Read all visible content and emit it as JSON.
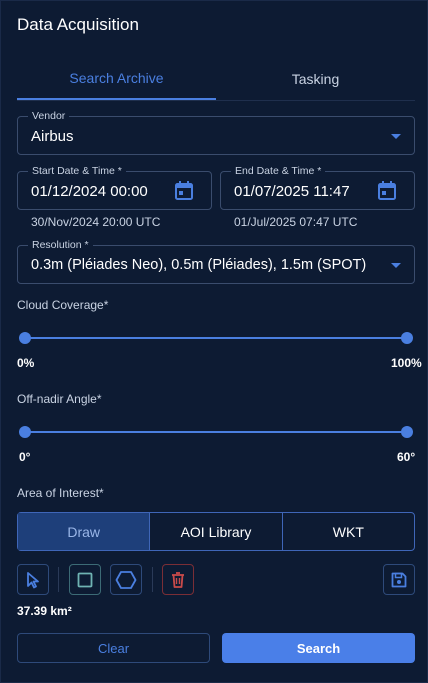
{
  "panel": {
    "title": "Data Acquisition"
  },
  "tabs": [
    {
      "label": "Search Archive",
      "active": true
    },
    {
      "label": "Tasking",
      "active": false
    }
  ],
  "vendor": {
    "label": "Vendor",
    "value": "Airbus"
  },
  "start_date": {
    "label": "Start Date & Time *",
    "value": "01/12/2024 00:00",
    "helper": "30/Nov/2024 20:00 UTC"
  },
  "end_date": {
    "label": "End Date & Time *",
    "value": "01/07/2025 11:47",
    "helper": "01/Jul/2025 07:47 UTC"
  },
  "resolution": {
    "label": "Resolution *",
    "value": "0.3m (Pléiades Neo), 0.5m (Pléiades), 1.5m (SPOT)"
  },
  "cloud_coverage": {
    "label": "Cloud Coverage*",
    "min_label": "0%",
    "max_label": "100%",
    "low": 0,
    "high": 100
  },
  "off_nadir": {
    "label": "Off-nadir Angle*",
    "min_label": "0°",
    "max_label": "60°",
    "low": 0,
    "high": 60
  },
  "aoi": {
    "label": "Area of Interest*",
    "modes": [
      {
        "label": "Draw",
        "active": true
      },
      {
        "label": "AOI Library",
        "active": false
      },
      {
        "label": "WKT",
        "active": false
      }
    ],
    "tools": [
      "cursor-icon",
      "rectangle-icon",
      "hexagon-icon",
      "trash-icon",
      "save-icon"
    ],
    "area_value": "37.39 km²"
  },
  "actions": {
    "clear_label": "Clear",
    "search_label": "Search"
  },
  "colors": {
    "accent": "#4a7fe0",
    "background": "#0d1b33",
    "danger": "#c94a4a",
    "teal": "#5fa8a8"
  }
}
